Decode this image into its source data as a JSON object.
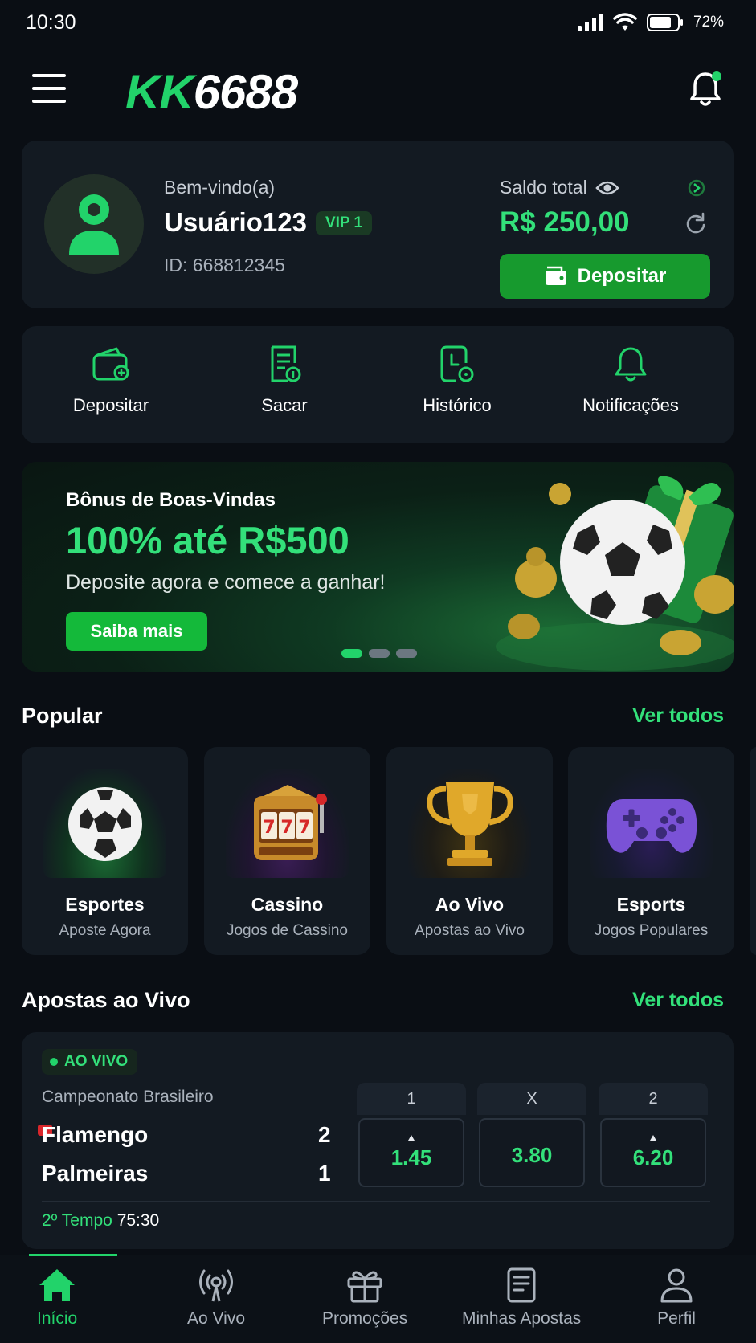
{
  "status_bar": {
    "time": "10:30",
    "battery": "72%"
  },
  "header": {
    "logo_green": "KK",
    "logo_white": "6688"
  },
  "user": {
    "welcome": "Bem-vindo(a)",
    "name": "Usuário123",
    "vip": "VIP 1",
    "id": "ID: 668812345",
    "balance_label": "Saldo total",
    "balance": "R$ 250,00",
    "deposit_label": "Depositar"
  },
  "quick_actions": [
    {
      "label": "Depositar",
      "icon": "wallet-icon"
    },
    {
      "label": "Sacar",
      "icon": "withdraw-icon"
    },
    {
      "label": "Histórico",
      "icon": "history-icon"
    },
    {
      "label": "Notificações",
      "icon": "bell-icon"
    }
  ],
  "banner": {
    "subtitle": "Bônus de Boas-Vindas",
    "title": "100% até R$500",
    "text": "Deposite agora e comece a ganhar!",
    "button": "Saiba mais",
    "active_slide": 1,
    "slides": 3
  },
  "popular": {
    "title": "Popular",
    "see_all": "Ver todos",
    "items": [
      {
        "name": "Esportes",
        "sub": "Aposte Agora",
        "icon": "soccer-ball-icon"
      },
      {
        "name": "Cassino",
        "sub": "Jogos de Cassino",
        "icon": "slot-machine-icon"
      },
      {
        "name": "Ao Vivo",
        "sub": "Apostas ao Vivo",
        "icon": "trophy-icon"
      },
      {
        "name": "Esports",
        "sub": "Jogos Populares",
        "icon": "gamepad-icon"
      }
    ]
  },
  "live": {
    "title": "Apostas ao Vivo",
    "see_all": "Ver todos",
    "badge": "AO VIVO",
    "league": "Campeonato Brasileiro",
    "home": {
      "name": "Flamengo",
      "score": "2"
    },
    "away": {
      "name": "Palmeiras",
      "score": "1"
    },
    "odds": [
      {
        "label": "1",
        "value": "1.45"
      },
      {
        "label": "X",
        "value": "3.80"
      },
      {
        "label": "2",
        "value": "6.20"
      }
    ],
    "period": "2º Tempo",
    "clock": "75:30"
  },
  "nav": [
    {
      "label": "Início",
      "icon": "home-icon",
      "active": true
    },
    {
      "label": "Ao Vivo",
      "icon": "live-broadcast-icon"
    },
    {
      "label": "Promoções",
      "icon": "gift-icon"
    },
    {
      "label": "Minhas Apostas",
      "icon": "bet-slip-icon"
    },
    {
      "label": "Perfil",
      "icon": "user-icon"
    }
  ],
  "colors": {
    "accent": "#22d36a",
    "background": "#0a0e14",
    "card": "#131a22",
    "button": "#179a2e"
  }
}
